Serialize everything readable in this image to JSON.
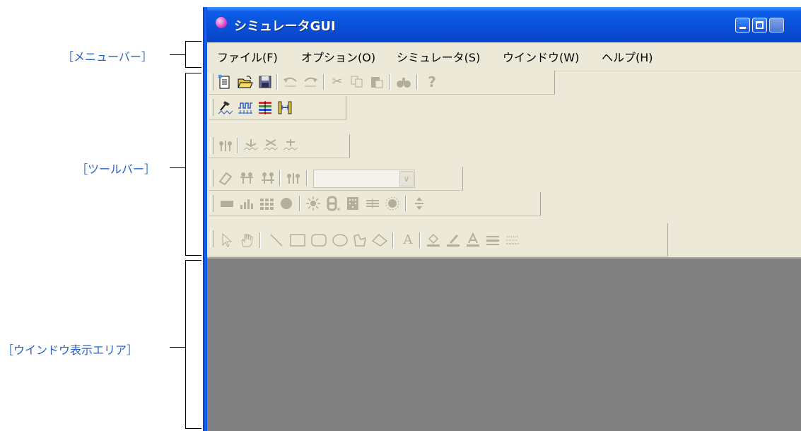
{
  "callouts": {
    "menubar": "［メニューバー］",
    "toolbar": "［ツールバー］",
    "window_area": "［ウインドウ表示エリア］"
  },
  "window": {
    "title": "シミュレータGUI",
    "menu": [
      "ファイル(F)",
      "オプション(O)",
      "シミュレータ(S)",
      "ウインドウ(W)",
      "ヘルプ(H)"
    ]
  },
  "toolbars": [
    {
      "name": "standard",
      "icons": [
        "new-file-icon",
        "open-folder-icon",
        "save-icon",
        "undo-icon",
        "redo-icon",
        "cut-icon",
        "copy-icon",
        "paste-icon",
        "find-icon",
        "help-icon"
      ]
    },
    {
      "name": "simulator",
      "icons": [
        "hammer-icon",
        "waveform-icon",
        "pin-matrix-icon",
        "bracket-link-icon"
      ]
    },
    {
      "name": "connection",
      "icons": [
        "pin-connect-icon",
        "signal-a-icon",
        "signal-b-icon",
        "signal-c-icon"
      ]
    },
    {
      "name": "parts-edit",
      "icons": [
        "eraser-icon",
        "pin-edit-a-icon",
        "pin-edit-b-icon",
        "pin-edit-c-icon",
        "combo-box"
      ]
    },
    {
      "name": "parts",
      "icons": [
        "button-part-icon",
        "level-meter-icon",
        "key-matrix-icon",
        "led-icon",
        "buzzer-icon",
        "seven-seg-icon",
        "matrix-led-icon",
        "lcd-icon",
        "light-icon",
        "pull-updown-icon"
      ]
    },
    {
      "name": "drawing",
      "icons": [
        "pointer-icon",
        "hand-icon",
        "line-icon",
        "rectangle-icon",
        "rounded-rect-icon",
        "ellipse-icon",
        "polygon-icon",
        "freeform-icon",
        "text-icon",
        "fill-color-icon",
        "line-color-icon",
        "font-color-icon",
        "line-style-icon",
        "dash-style-icon"
      ]
    }
  ],
  "colors": {
    "accent_label": "#2a62c8",
    "titlebar": "#0a50d8",
    "workarea": "#808080",
    "face": "#ece9d8"
  }
}
